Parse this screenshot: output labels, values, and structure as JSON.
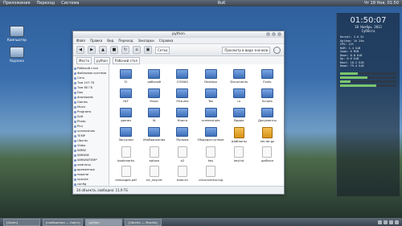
{
  "top_panel": {
    "menus": [
      "Приложения",
      "Переход",
      "Система"
    ],
    "tray_text": "RuK",
    "clock": "Чт 18 Ноя, 01:50"
  },
  "desktop_icons": [
    {
      "label": "Компьютер"
    },
    {
      "label": "Корзина"
    }
  ],
  "window": {
    "title": "python",
    "menu": [
      "Файл",
      "Правка",
      "Вид",
      "Переход",
      "Закладки",
      "Справка"
    ],
    "toolbar": {
      "view_name": "Сетка",
      "view_mode": "Просмотр в виде значков"
    },
    "location": {
      "places": "Места",
      "crumbs": [
        "python",
        "Рабочий стол"
      ]
    },
    "sidebar": [
      "Рабочий стол",
      "Файловая система",
      "Сеть",
      "Том 107 ГБ",
      "Том 80 ГБ",
      "Dox",
      "downloads",
      "Games",
      "Music",
      "Programs",
      "Soft",
      "Photo",
      "Pics",
      "screenshots",
      "TEMP",
      "Ubuntu",
      "Video",
      "WWW",
      "WWWW",
      "WWWWTEMP",
      "комнаты",
      "временные",
      "пароли",
      "прочее",
      "config",
      "openbox",
      "conky",
      "лето"
    ],
    "files": [
      {
        "label": "f1",
        "type": "folder"
      },
      {
        "label": "рабочий",
        "type": "folder"
      },
      {
        "label": "COMAG",
        "type": "folder"
      },
      {
        "label": "Desktop",
        "type": "folder"
      },
      {
        "label": "Documents",
        "type": "folder"
      },
      {
        "label": "Fonts",
        "type": "folder"
      },
      {
        "label": "HLT",
        "type": "folder"
      },
      {
        "label": "Music",
        "type": "folder"
      },
      {
        "label": "Pictures",
        "type": "folder"
      },
      {
        "label": "Tex",
        "type": "folder"
      },
      {
        "label": "ru",
        "type": "folder"
      },
      {
        "label": "Scripts",
        "type": "folder"
      },
      {
        "label": "games",
        "type": "folder"
      },
      {
        "label": "lit",
        "type": "folder"
      },
      {
        "label": "Книги",
        "type": "folder"
      },
      {
        "label": "screenshots",
        "type": "folder"
      },
      {
        "label": "Видео",
        "type": "folder"
      },
      {
        "label": "Документы",
        "type": "folder"
      },
      {
        "label": "Загрузки",
        "type": "folder"
      },
      {
        "label": "Изображения",
        "type": "folder"
      },
      {
        "label": "Музыка",
        "type": "folder"
      },
      {
        "label": "Общедоступные",
        "type": "folder"
      },
      {
        "label": "Шаблоны",
        "type": "archive"
      },
      {
        "label": "sfx.tar.gz",
        "type": "archive"
      },
      {
        "label": "bookmarks",
        "type": "doc"
      },
      {
        "label": "eplaza",
        "type": "doc"
      },
      {
        "label": "a2",
        "type": "doc"
      },
      {
        "label": "key",
        "type": "doc"
      },
      {
        "label": "key.txt",
        "type": "doc"
      },
      {
        "label": "шаблон",
        "type": "doc"
      },
      {
        "label": "messages.pdf",
        "type": "doc"
      },
      {
        "label": "src_key.txt",
        "type": "doc"
      },
      {
        "label": "todo.sh",
        "type": "doc"
      },
      {
        "label": "urlconvertor.log",
        "type": "doc"
      }
    ],
    "status": "34 объекта, свободно: 11,9 ГБ"
  },
  "conky": {
    "clock": "01:50:07",
    "date": "18 Ноябрь 2012",
    "day": "Суббота",
    "lines": [
      "Kernel: 2.6.32",
      "Uptime: 1h 24m",
      "CPU: 12%",
      "RAM: 1.4 GiB",
      "Swap: 0 MiB",
      "Down: 0.0 KiB",
      "Up: 0.0 KiB",
      "Root: 18.2 GiB",
      "Home: 79.4 GiB"
    ],
    "bars": [
      0.32,
      0.48,
      0.18,
      0.64
    ]
  },
  "taskbar": {
    "items": [
      {
        "label": "[Gajim]",
        "active": false
      },
      {
        "label": "[сообщения — Gajim]",
        "active": false
      },
      {
        "label": "python",
        "active": true
      },
      {
        "label": "[Ubuntu — Mozilla]",
        "active": false
      }
    ]
  },
  "colors": {
    "desktop_sky": "#3a6fae",
    "folder_blue": "#3d6fb8",
    "panel": "#394450"
  }
}
